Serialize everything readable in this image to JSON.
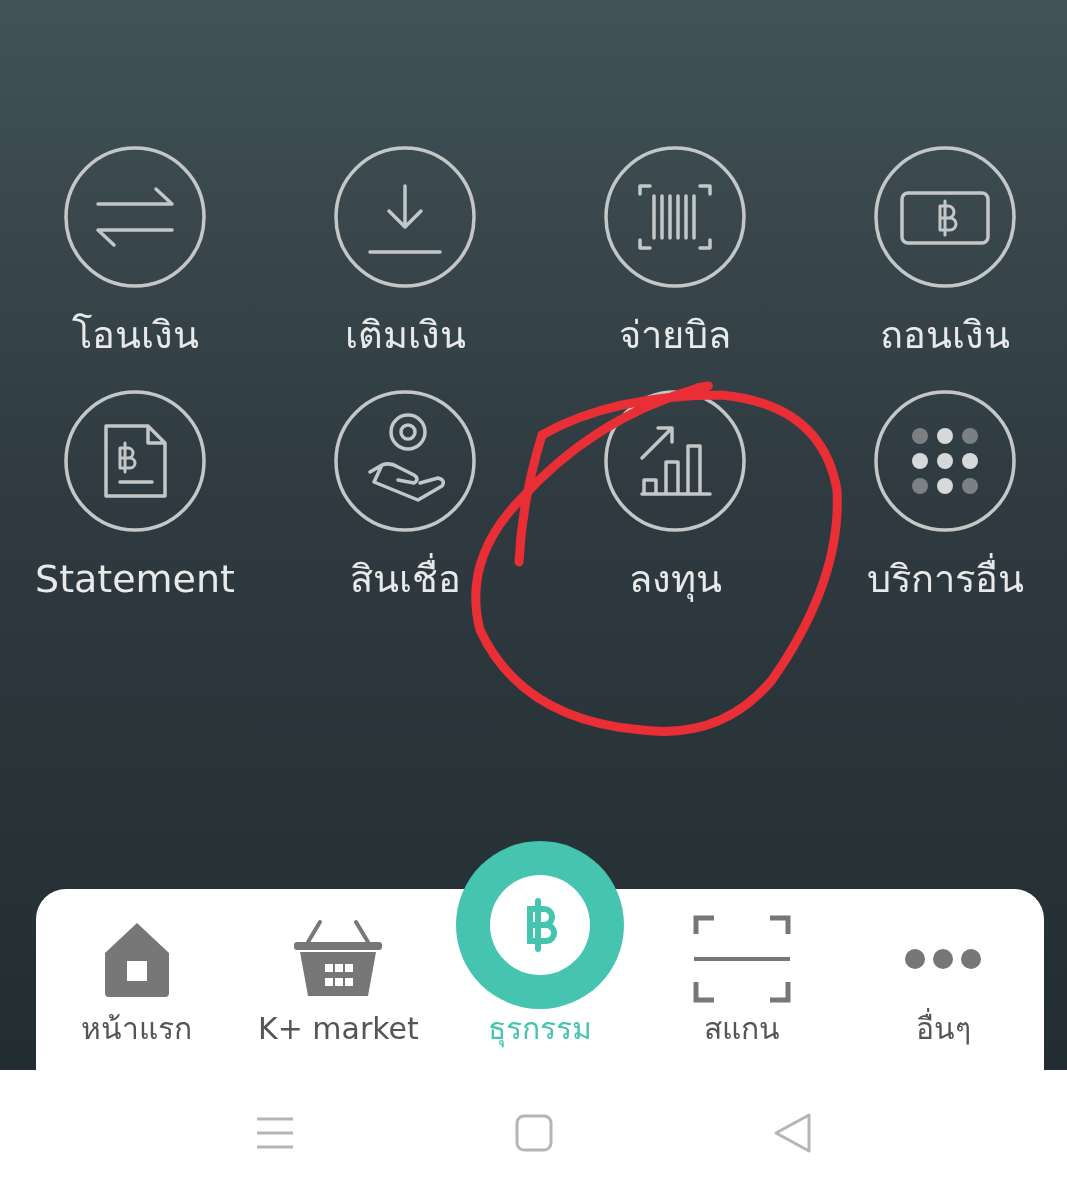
{
  "actions": [
    {
      "label": "โอนเงิน",
      "kind": "transfer"
    },
    {
      "label": "เติมเงิน",
      "kind": "topup"
    },
    {
      "label": "จ่ายบิล",
      "kind": "bill"
    },
    {
      "label": "ถอนเงิน",
      "kind": "withdraw"
    },
    {
      "label": "Statement",
      "kind": "statement"
    },
    {
      "label": "สินเชื่อ",
      "kind": "loan"
    },
    {
      "label": "ลงทุน",
      "kind": "invest"
    },
    {
      "label": "บริการอื่น",
      "kind": "more"
    }
  ],
  "nav": [
    {
      "label": "หน้าแรก",
      "kind": "home",
      "selected": false
    },
    {
      "label": "K+ market",
      "kind": "market",
      "selected": false
    },
    {
      "label": "ธุรกรรม",
      "kind": "baht",
      "selected": true
    },
    {
      "label": "สแกน",
      "kind": "scan",
      "selected": false
    },
    {
      "label": "อื่นๆ",
      "kind": "dots",
      "selected": false
    }
  ]
}
